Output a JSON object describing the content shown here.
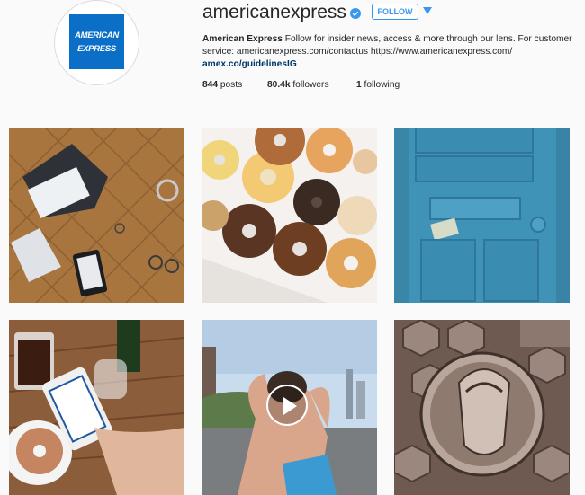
{
  "profile": {
    "username": "americanexpress",
    "verified": true,
    "follow_label": "FOLLOW",
    "logo_line1": "AMERICAN",
    "logo_line2": "EXPRESS",
    "full_name": "American Express",
    "bio_text": "Follow for insider news, access & more through our lens. For customer service: americanexpress.com/contactus https://www.americanexpress.com/",
    "bio_link": "amex.co/guidelinesIG",
    "brand_color": "#0b6fc7",
    "accent_color": "#3897f0"
  },
  "stats": {
    "posts_count": "844",
    "posts_label": "posts",
    "followers_count": "80.4k",
    "followers_label": "followers",
    "following_count": "1",
    "following_label": "following"
  },
  "grid": [
    {
      "subject": "leather-tufted-surface-with-accessories"
    },
    {
      "subject": "assorted-donuts-in-box"
    },
    {
      "subject": "blue-door-with-mail-slot"
    },
    {
      "subject": "coffee-donut-phone-on-table"
    },
    {
      "subject": "video-person-stretching-city-skyline",
      "is_video": true
    },
    {
      "subject": "engraved-card-art-centurion"
    }
  ]
}
